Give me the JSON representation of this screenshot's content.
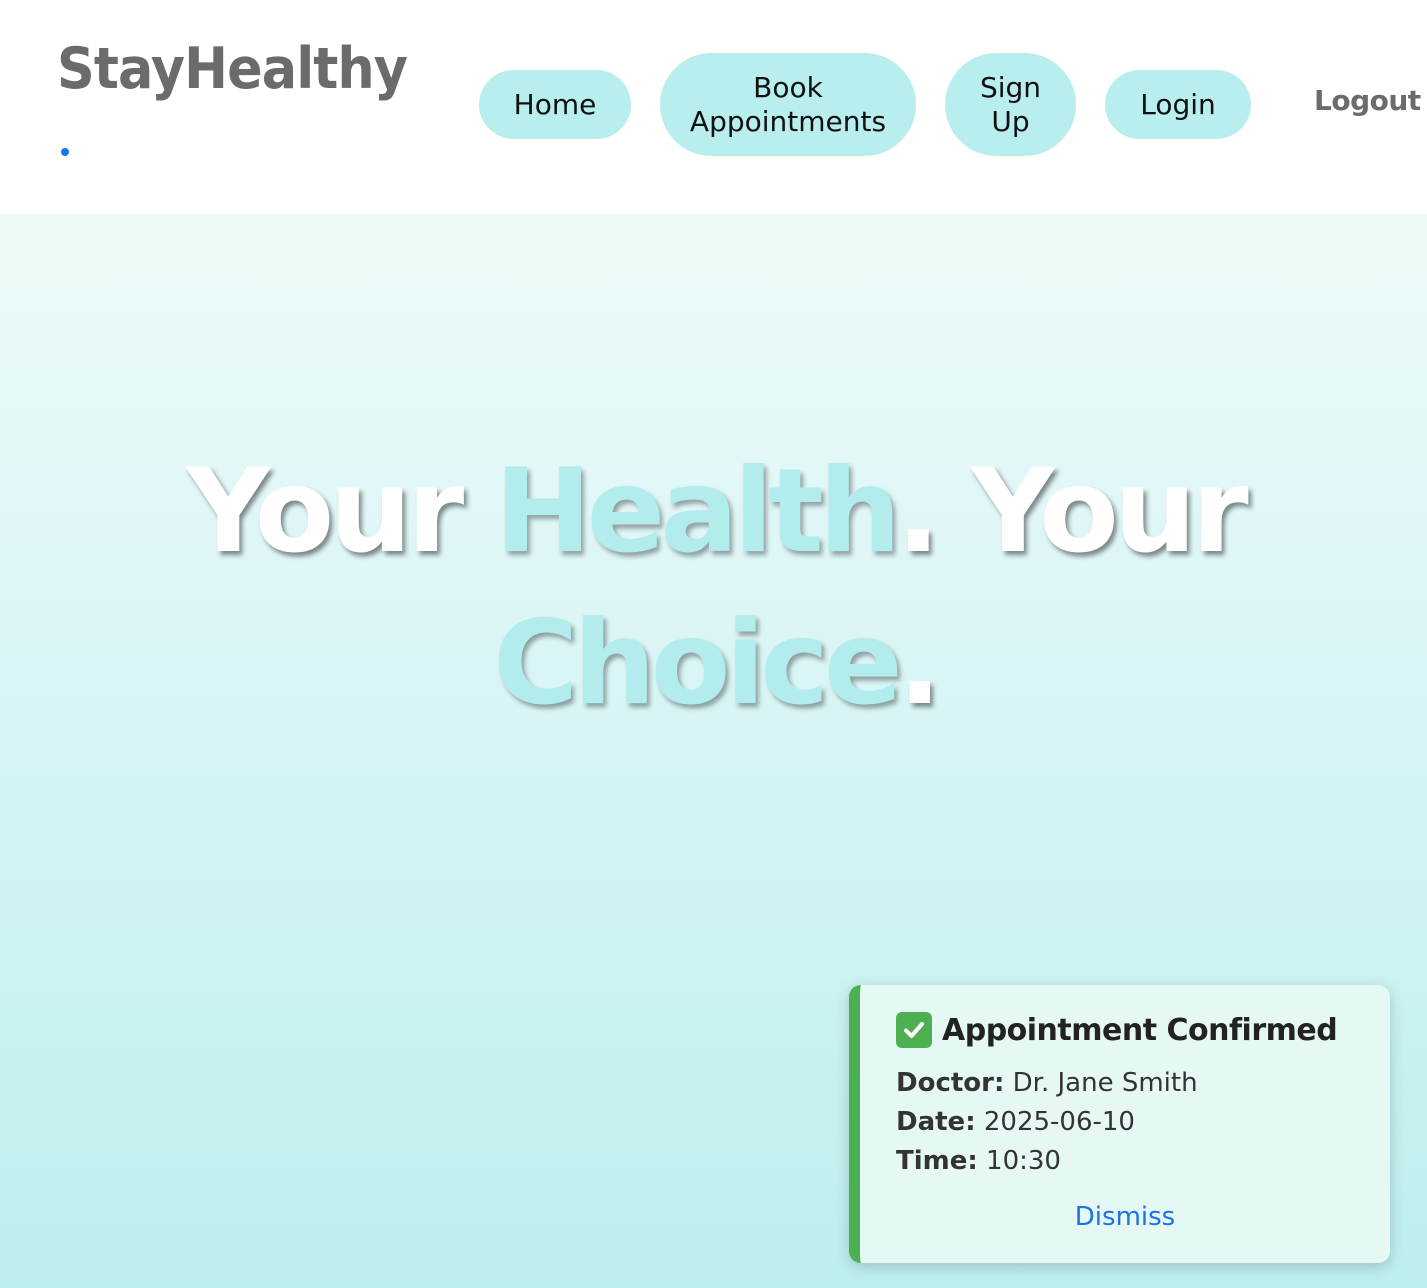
{
  "header": {
    "brand": "StayHealthy",
    "nav": {
      "home": "Home",
      "book_line1": "Book",
      "book_line2": "Appointments",
      "signup_line1": "Sign",
      "signup_line2": "Up",
      "login": "Login",
      "logout": "Logout"
    }
  },
  "hero": {
    "title_part1": "Your ",
    "title_accent1": "Health",
    "title_part2": ". Your",
    "title_accent2": "Choice",
    "title_part3": "."
  },
  "toast": {
    "icon": "check-icon",
    "title": "Appointment Confirmed",
    "doctor_label": "Doctor:",
    "doctor_value": " Dr. Jane Smith",
    "date_label": "Date:",
    "date_value": " 2025-06-10",
    "time_label": "Time:",
    "time_value": " 10:30",
    "dismiss": "Dismiss"
  },
  "colors": {
    "accent": "#b9eeee",
    "success": "#4caf50",
    "link": "#1a73e8"
  }
}
